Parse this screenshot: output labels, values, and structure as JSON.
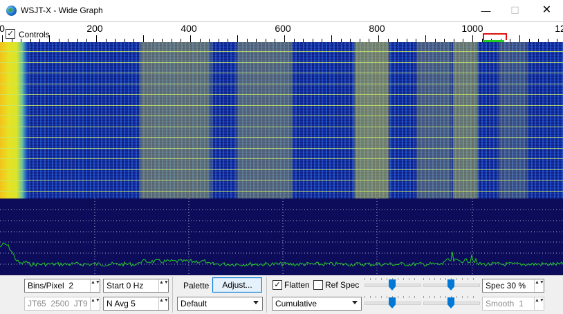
{
  "window": {
    "title": "WSJT-X - Wide Graph",
    "minimize": "—",
    "maximize": "☐",
    "close": "✕"
  },
  "scale": {
    "controls_label": "Controls",
    "controls_checked": "✓",
    "freq_labels": [
      "0",
      "200",
      "400",
      "600",
      "800",
      "1000",
      "12"
    ]
  },
  "panel": {
    "bins_per_pixel": "Bins/Pixel  2",
    "start": "Start 0 Hz",
    "mode_indicator": "JT65  2500  JT9",
    "n_avg": "N Avg 5",
    "palette_label": "Palette",
    "adjust_button": "Adjust...",
    "palette_value": "Default",
    "flatten_label": "Flatten",
    "flatten_checked": "✓",
    "ref_spec_label": "Ref Spec",
    "spectrum_type": "Cumulative",
    "spec": "Spec 30 %",
    "smooth": "Smooth  1",
    "spin_arrows": "▲▼"
  },
  "colors": {
    "accent": "#0078d7",
    "spectrum_line": "#22cc22",
    "waterfall_bg": "#1b3fb4",
    "rx_marker": "#e01010"
  }
}
